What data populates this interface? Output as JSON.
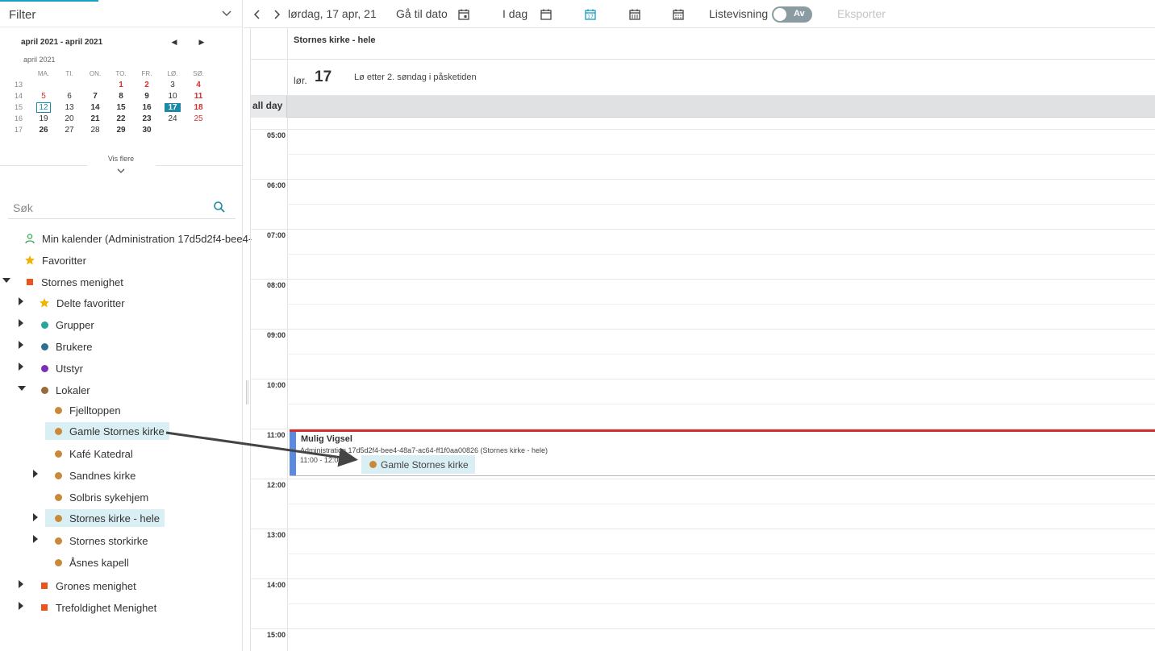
{
  "sidebar": {
    "filter_label": "Filter",
    "mini_calendar": {
      "range": "april 2021 - april 2021",
      "month_label": "april 2021",
      "weekdays": [
        "MA.",
        "TI.",
        "ON.",
        "TO.",
        "FR.",
        "LØ.",
        "SØ."
      ],
      "weeks": [
        {
          "wk": "13",
          "days": [
            "",
            "",
            "",
            "1",
            "2",
            "3",
            "4"
          ]
        },
        {
          "wk": "14",
          "days": [
            "5",
            "6",
            "7",
            "8",
            "9",
            "10",
            "11"
          ]
        },
        {
          "wk": "15",
          "days": [
            "12",
            "13",
            "14",
            "15",
            "16",
            "17",
            "18"
          ]
        },
        {
          "wk": "16",
          "days": [
            "19",
            "20",
            "21",
            "22",
            "23",
            "24",
            "25"
          ]
        },
        {
          "wk": "17",
          "days": [
            "26",
            "27",
            "28",
            "29",
            "30",
            "",
            ""
          ]
        }
      ],
      "today": "12",
      "selected": "17",
      "show_more": "Vis flere"
    },
    "search_placeholder": "Søk",
    "tree": [
      {
        "label": "Min kalender (Administration 17d5d2f4-bee4-",
        "icon": "user-icon"
      },
      {
        "label": "Favoritter",
        "icon": "star-icon"
      },
      {
        "label": "Stornes menighet",
        "icon": "square"
      },
      {
        "label": "Delte favoritter",
        "icon": "star-icon"
      },
      {
        "label": "Grupper",
        "icon": "dot"
      },
      {
        "label": "Brukere",
        "icon": "dot"
      },
      {
        "label": "Utstyr",
        "icon": "dot"
      },
      {
        "label": "Lokaler",
        "icon": "dot"
      },
      {
        "label": "Fjelltoppen",
        "icon": "dot"
      },
      {
        "label": "Gamle Stornes kirke",
        "icon": "dot"
      },
      {
        "label": "Kafé Katedral",
        "icon": "dot"
      },
      {
        "label": "Sandnes kirke",
        "icon": "dot"
      },
      {
        "label": "Solbris sykehjem",
        "icon": "dot"
      },
      {
        "label": "Stornes kirke - hele",
        "icon": "dot"
      },
      {
        "label": "Stornes storkirke",
        "icon": "dot"
      },
      {
        "label": "Åsnes kapell",
        "icon": "dot"
      },
      {
        "label": "Grones menighet",
        "icon": "square"
      },
      {
        "label": "Trefoldighet Menighet",
        "icon": "square"
      }
    ]
  },
  "toolbar": {
    "date_label": "lørdag, 17 apr, 21",
    "goto_date": "Gå til dato",
    "today": "I dag",
    "list_view": "Listevisning",
    "toggle_state": "Av",
    "export": "Eksporter"
  },
  "calendar": {
    "resource": "Stornes kirke - hele",
    "day_abbr": "lør.",
    "day_num": "17",
    "day_desc": "Lø  etter 2. søndag i påsketiden",
    "allday_label": "all day",
    "hours": [
      "05:00",
      "06:00",
      "07:00",
      "08:00",
      "09:00",
      "10:00",
      "11:00",
      "12:00",
      "13:00",
      "14:00",
      "15:00"
    ],
    "event": {
      "title": "Mulig Vigsel",
      "subtitle": "Administration 17d5d2f4-bee4-48a7-ac64-ff1f0aa00826 (Stornes kirke - hele)",
      "time": "11:00 - 12:00",
      "resource": "Gamle Stornes kirke"
    }
  },
  "colors": {
    "accent": "#1a8aa6",
    "highlight": "#d9eff4",
    "event_bar": "#5b8be0",
    "now_line": "#d32f2f",
    "favorite_star": "#f0b400",
    "org_square": "#e8561c",
    "group_dot": "#26a69a",
    "users_dot": "#2f6f8f",
    "equipment_dot": "#7b2fb5",
    "venue_dot": "#9a6a3a",
    "venue_child_dot": "#c88a3a"
  }
}
